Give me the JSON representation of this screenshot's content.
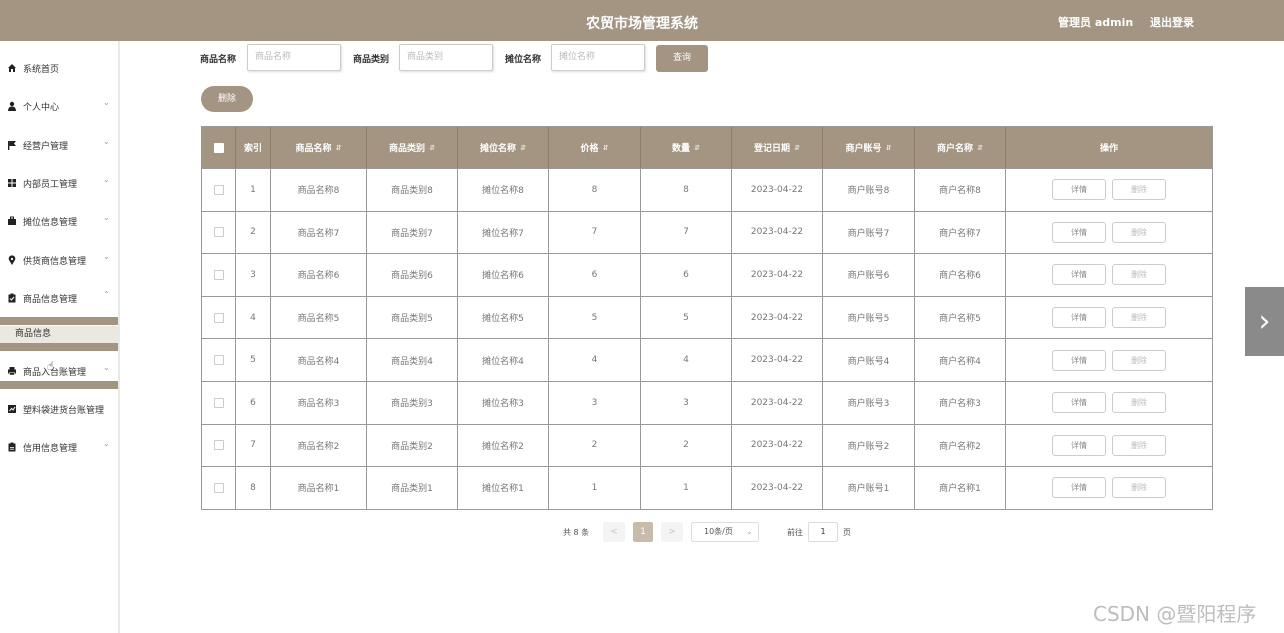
{
  "header": {
    "title": "农贸市场管理系统",
    "user": "管理员 admin",
    "logout": "退出登录"
  },
  "sidebar": {
    "items": [
      {
        "label": "系统首页",
        "icon": "home-icon"
      },
      {
        "label": "个人中心",
        "icon": "user-icon"
      },
      {
        "label": "经营户管理",
        "icon": "flag-icon"
      },
      {
        "label": "内部员工管理",
        "icon": "grid-icon"
      },
      {
        "label": "摊位信息管理",
        "icon": "briefcase-icon"
      },
      {
        "label": "供货商信息管理",
        "icon": "location-pin-icon"
      },
      {
        "label": "商品信息管理",
        "icon": "clipboard-check-icon"
      },
      {
        "label": "商品入台账管理",
        "icon": "printer-icon"
      },
      {
        "label": "塑料袋进货台账管理",
        "icon": "chart-icon"
      },
      {
        "label": "信用信息管理",
        "icon": "document-icon"
      }
    ],
    "submenu_active": "商品信息"
  },
  "filters": {
    "name_label": "商品名称",
    "name_placeholder": "商品名称",
    "category_label": "商品类别",
    "category_placeholder": "商品类别",
    "stall_label": "摊位名称",
    "stall_placeholder": "摊位名称",
    "query_button": "查询"
  },
  "toolbar": {
    "delete_button": "删除"
  },
  "table": {
    "headers": [
      "索引",
      "商品名称",
      "商品类别",
      "摊位名称",
      "价格",
      "数量",
      "登记日期",
      "商户账号",
      "商户名称",
      "操作"
    ],
    "rows": [
      [
        "1",
        "商品名称8",
        "商品类别8",
        "摊位名称8",
        "8",
        "8",
        "2023-04-22",
        "商户账号8",
        "商户名称8"
      ],
      [
        "2",
        "商品名称7",
        "商品类别7",
        "摊位名称7",
        "7",
        "7",
        "2023-04-22",
        "商户账号7",
        "商户名称7"
      ],
      [
        "3",
        "商品名称6",
        "商品类别6",
        "摊位名称6",
        "6",
        "6",
        "2023-04-22",
        "商户账号6",
        "商户名称6"
      ],
      [
        "4",
        "商品名称5",
        "商品类别5",
        "摊位名称5",
        "5",
        "5",
        "2023-04-22",
        "商户账号5",
        "商户名称5"
      ],
      [
        "5",
        "商品名称4",
        "商品类别4",
        "摊位名称4",
        "4",
        "4",
        "2023-04-22",
        "商户账号4",
        "商户名称4"
      ],
      [
        "6",
        "商品名称3",
        "商品类别3",
        "摊位名称3",
        "3",
        "3",
        "2023-04-22",
        "商户账号3",
        "商户名称3"
      ],
      [
        "7",
        "商品名称2",
        "商品类别2",
        "摊位名称2",
        "2",
        "2",
        "2023-04-22",
        "商户账号2",
        "商户名称2"
      ],
      [
        "8",
        "商品名称1",
        "商品类别1",
        "摊位名称1",
        "1",
        "1",
        "2023-04-22",
        "商户账号1",
        "商户名称1"
      ]
    ],
    "detail_label": "详情",
    "delete_label": "删除"
  },
  "pagination": {
    "total": "共 8 条",
    "prev": "<",
    "current": "1",
    "next": ">",
    "page_size": "10条/页",
    "goto_label": "前往",
    "goto_value": "1",
    "page_suffix": "页"
  },
  "watermark": "CSDN @暨阳程序",
  "colors": {
    "accent": "#a39582",
    "header_bg": "#a39582"
  }
}
